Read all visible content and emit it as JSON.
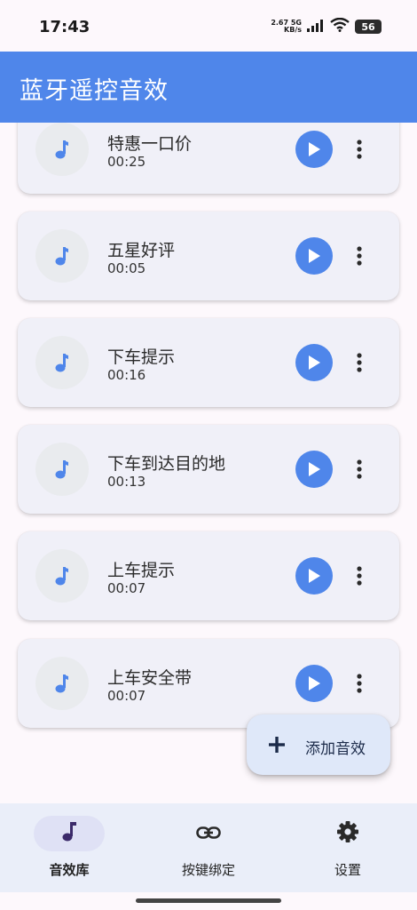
{
  "status_bar": {
    "time": "17:43",
    "net_speed_value": "2.67",
    "net_speed_unit": "KB/s",
    "network_type": "5G",
    "battery_level": "56",
    "icons": [
      "signal-icon",
      "wifi-icon",
      "battery-icon"
    ]
  },
  "app_bar": {
    "title": "蓝牙遥控音效",
    "background_color": "#4f86ea"
  },
  "sounds": [
    {
      "title": "特惠一口价",
      "duration": "00:25"
    },
    {
      "title": "五星好评",
      "duration": "00:05"
    },
    {
      "title": "下车提示",
      "duration": "00:16"
    },
    {
      "title": "下车到达目的地",
      "duration": "00:13"
    },
    {
      "title": "上车提示",
      "duration": "00:07"
    },
    {
      "title": "上车安全带",
      "duration": "00:07"
    }
  ],
  "fab": {
    "label": "添加音效",
    "icon": "plus-icon"
  },
  "bottom_nav": {
    "items": [
      {
        "label": "音效库",
        "icon": "music-note-icon",
        "active": true
      },
      {
        "label": "按键绑定",
        "icon": "link-icon",
        "active": false
      },
      {
        "label": "设置",
        "icon": "gear-icon",
        "active": false
      }
    ]
  },
  "colors": {
    "accent": "#4f86ea",
    "card_background": "#f0f0f8",
    "nav_background": "#eaeef9",
    "active_indicator": "#dfe1f5"
  }
}
